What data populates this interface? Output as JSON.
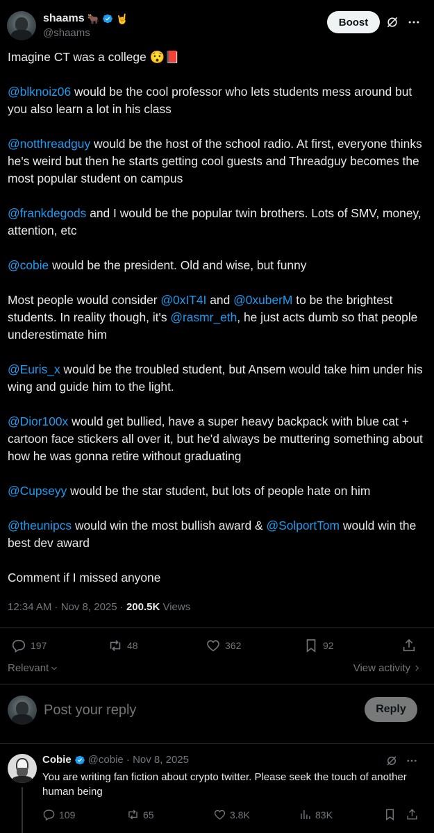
{
  "author": {
    "display_name": "shaams",
    "emoji_badges": "🐂",
    "affiliate_badge": "🤘",
    "handle": "@shaams"
  },
  "header": {
    "boost_label": "Boost",
    "grok_icon": "grok-icon",
    "more_icon": "more-icon"
  },
  "tweet": {
    "paragraphs": [
      [
        {
          "t": "Imagine CT was a college 😯📕"
        }
      ],
      [
        {
          "t": "@blknoiz06",
          "m": true
        },
        {
          "t": " would be the cool professor who lets students mess around but you also learn a lot in his class"
        }
      ],
      [
        {
          "t": "@notthreadguy",
          "m": true
        },
        {
          "t": " would be the host of the school radio. At first, everyone thinks he's weird but then he starts getting cool guests and Threadguy becomes the most popular student on campus"
        }
      ],
      [
        {
          "t": "@frankdegods",
          "m": true
        },
        {
          "t": " and I would be the popular twin brothers. Lots of SMV, money, attention, etc"
        }
      ],
      [
        {
          "t": "@cobie",
          "m": true
        },
        {
          "t": " would be the president. Old and wise, but funny"
        }
      ],
      [
        {
          "t": "Most people would consider "
        },
        {
          "t": "@0xIT4I",
          "m": true
        },
        {
          "t": " and "
        },
        {
          "t": "@0xuberM",
          "m": true
        },
        {
          "t": " to be the brightest students. In reality though, it's "
        },
        {
          "t": "@rasmr_eth",
          "m": true
        },
        {
          "t": ", he just acts dumb so that people underestimate him"
        }
      ],
      [
        {
          "t": "@Euris_x",
          "m": true
        },
        {
          "t": " would be the troubled student, but Ansem would take him under his wing and guide him to the light."
        }
      ],
      [
        {
          "t": "@Dior100x",
          "m": true
        },
        {
          "t": " would get bullied, have a super heavy backpack with blue cat + cartoon face stickers all over it, but he'd always be muttering something about how he was gonna retire without graduating"
        }
      ],
      [
        {
          "t": "@Cupseyy",
          "m": true
        },
        {
          "t": " would be the star student, but lots of people hate on him"
        }
      ],
      [
        {
          "t": "@theunipcs",
          "m": true
        },
        {
          "t": " would win the most bullish award & "
        },
        {
          "t": "@SolportTom",
          "m": true
        },
        {
          "t": " would win the best dev award"
        }
      ],
      [
        {
          "t": "Comment if I missed anyone"
        }
      ]
    ],
    "time": "12:34 AM · Nov 8, 2025 · ",
    "views_count": "200.5K",
    "views_label": " Views"
  },
  "actions": {
    "replies": "197",
    "reposts": "48",
    "likes": "362",
    "bookmarks": "92"
  },
  "sort": {
    "relevant_label": "Relevant",
    "view_activity_label": "View activity"
  },
  "reply_box": {
    "placeholder": "Post your reply",
    "reply_label": "Reply"
  },
  "reply": {
    "name": "Cobie",
    "handle_date": "@cobie · Nov 8, 2025",
    "text": "You are writing fan fiction about crypto twitter. Please seek the touch of another human being",
    "replies": "109",
    "reposts": "65",
    "likes": "3.8K",
    "views": "83K"
  },
  "colors": {
    "background": "#000000",
    "text": "#e7e9ea",
    "muted": "#71767b",
    "link": "#1d9bf0",
    "verified": "#1d9bf0",
    "divider": "#2f3336"
  }
}
